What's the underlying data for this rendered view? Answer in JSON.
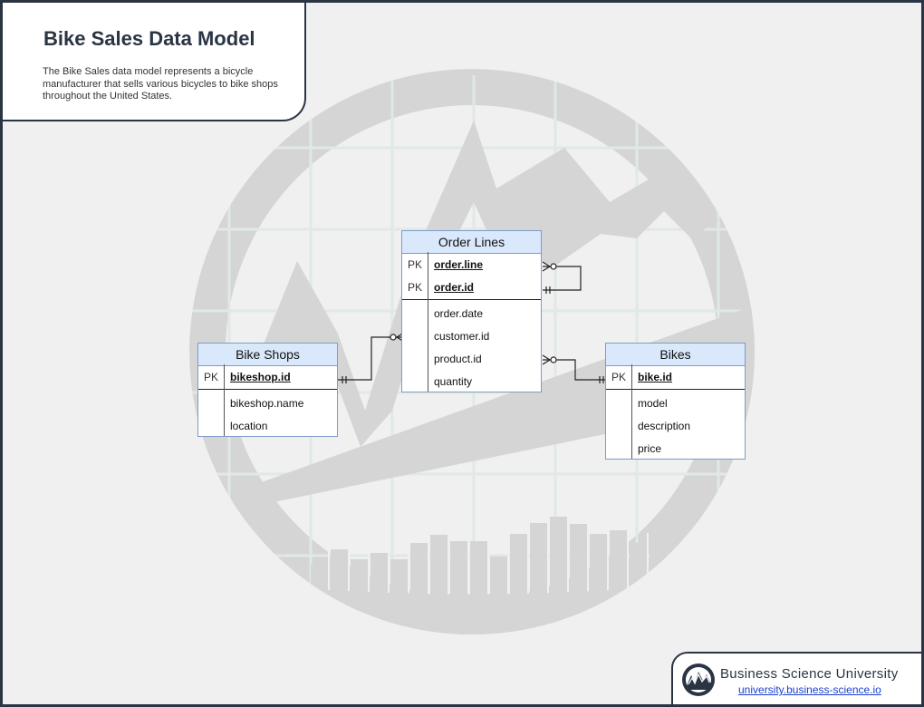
{
  "title": "Bike Sales Data Model",
  "description": "The Bike Sales data model represents a bicycle manufacturer that sells various bicycles to bike shops throughout the United States.",
  "entities": {
    "bike_shops": {
      "name": "Bike Shops",
      "pk": [
        {
          "key": "PK",
          "field": "bikeshop.id"
        }
      ],
      "fields": [
        "bikeshop.name",
        "location"
      ]
    },
    "order_lines": {
      "name": "Order Lines",
      "pk": [
        {
          "key": "PK",
          "field": "order.line"
        },
        {
          "key": "PK",
          "field": "order.id"
        }
      ],
      "fields": [
        "order.date",
        "customer.id",
        "product.id",
        "quantity"
      ]
    },
    "bikes": {
      "name": "Bikes",
      "pk": [
        {
          "key": "PK",
          "field": "bike.id"
        }
      ],
      "fields": [
        "model",
        "description",
        "price"
      ]
    }
  },
  "relationships": [
    {
      "from": "bike_shops.bikeshop.id",
      "from_cardinality": "one-and-only-one",
      "to": "order_lines.customer.id",
      "to_cardinality": "zero-or-many"
    },
    {
      "from": "bikes.bike.id",
      "from_cardinality": "one-and-only-one",
      "to": "order_lines.product.id",
      "to_cardinality": "zero-or-many"
    },
    {
      "from": "order_lines.order.id",
      "from_cardinality": "one-and-only-one",
      "to": "order_lines.order.line",
      "to_cardinality": "zero-or-many"
    }
  ],
  "brand": {
    "name": "Business Science University",
    "url": "university.business-science.io"
  },
  "colors": {
    "frame": "#2a3444",
    "entity_header": "#dae8fc",
    "entity_border": "#7c9cc8",
    "background": "#f0f0f0",
    "watermark": "#d5d5d5",
    "link": "#1a3fd0"
  }
}
